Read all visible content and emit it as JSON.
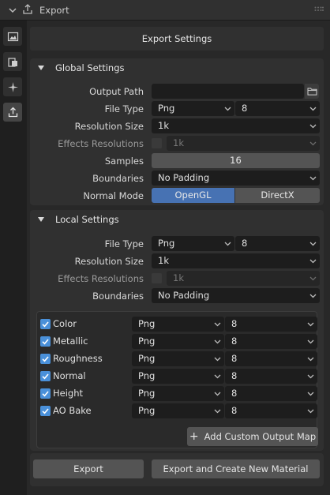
{
  "panel_title": "Export",
  "sidebar": {
    "items": [
      {
        "icon": "image-icon"
      },
      {
        "icon": "texture-icon"
      },
      {
        "icon": "sparkle-icon"
      },
      {
        "icon": "export-icon",
        "active": true
      }
    ]
  },
  "header_button": "Export Settings",
  "global": {
    "title": "Global Settings",
    "output_path_label": "Output Path",
    "output_path_value": "",
    "file_type_label": "File Type",
    "file_type_value": "Png",
    "bit_depth_value": "8",
    "resolution_label": "Resolution Size",
    "resolution_value": "1k",
    "effects_label": "Effects Resolutions",
    "effects_value": "1k",
    "samples_label": "Samples",
    "samples_value": "16",
    "boundaries_label": "Boundaries",
    "boundaries_value": "No Padding",
    "normal_mode_label": "Normal Mode",
    "normal_mode_options": [
      "OpenGL",
      "DirectX"
    ],
    "normal_mode_selected": "OpenGL"
  },
  "local": {
    "title": "Local Settings",
    "file_type_label": "File Type",
    "file_type_value": "Png",
    "bit_depth_value": "8",
    "resolution_label": "Resolution Size",
    "resolution_value": "1k",
    "effects_label": "Effects Resolutions",
    "effects_value": "1k",
    "boundaries_label": "Boundaries",
    "boundaries_value": "No Padding",
    "maps": [
      {
        "name": "Color",
        "checked": true,
        "format": "Png",
        "depth": "8"
      },
      {
        "name": "Metallic",
        "checked": true,
        "format": "Png",
        "depth": "8"
      },
      {
        "name": "Roughness",
        "checked": true,
        "format": "Png",
        "depth": "8"
      },
      {
        "name": "Normal",
        "checked": true,
        "format": "Png",
        "depth": "8"
      },
      {
        "name": "Height",
        "checked": true,
        "format": "Png",
        "depth": "8"
      },
      {
        "name": "AO Bake",
        "checked": true,
        "format": "Png",
        "depth": "8"
      }
    ],
    "add_map_label": "Add Custom Output Map"
  },
  "footer": {
    "export_label": "Export",
    "export_material_label": "Export and Create New Material"
  },
  "colors": {
    "accent": "#4772b3",
    "checkbox": "#4a90d9"
  }
}
